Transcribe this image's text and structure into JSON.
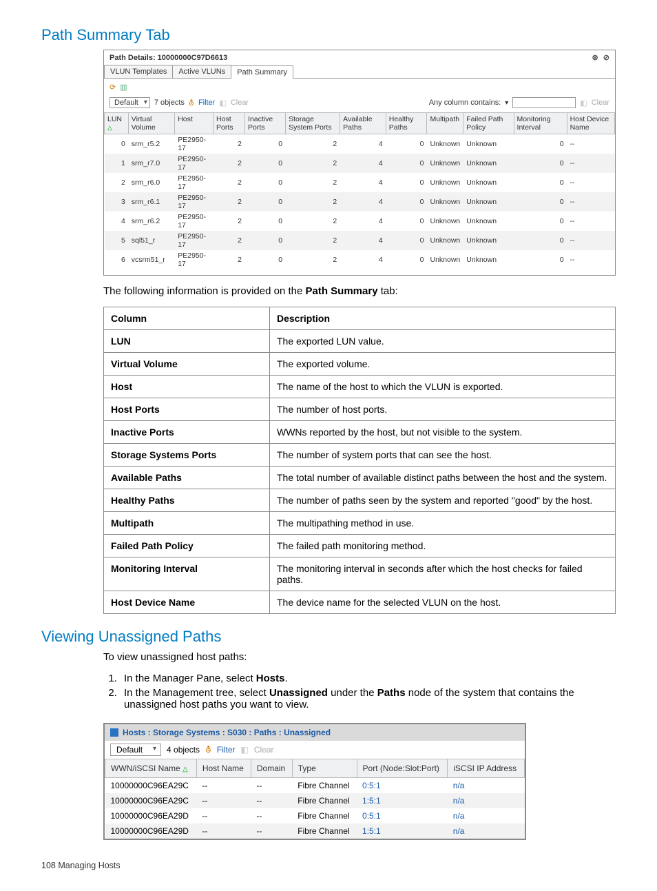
{
  "heading1": "Path Summary Tab",
  "panel1": {
    "title": "Path Details: 10000000C97D6613",
    "tabs": [
      "VLUN Templates",
      "Active VLUNs",
      "Path Summary"
    ],
    "activeTab": 2,
    "filter": {
      "default": "Default",
      "objects": "7 objects",
      "filter": "Filter",
      "clear": "Clear",
      "anycol": "Any column contains:",
      "clear2": "Clear"
    },
    "headers": [
      "LUN",
      "Virtual Volume",
      "Host",
      "Host Ports",
      "Inactive Ports",
      "Storage System Ports",
      "Available Paths",
      "Healthy Paths",
      "Multipath",
      "Failed Path Policy",
      "Monitoring Interval",
      "Host Device Name"
    ],
    "rows": [
      {
        "lun": "0",
        "vv": "srm_r5.2",
        "host": "PE2950-17",
        "hp": "2",
        "ip": "0",
        "sp": "2",
        "ap": "4",
        "heal": "0",
        "mp": "Unknown",
        "fp": "Unknown",
        "mi": "0",
        "hd": "--"
      },
      {
        "lun": "1",
        "vv": "srm_r7.0",
        "host": "PE2950-17",
        "hp": "2",
        "ip": "0",
        "sp": "2",
        "ap": "4",
        "heal": "0",
        "mp": "Unknown",
        "fp": "Unknown",
        "mi": "0",
        "hd": "--"
      },
      {
        "lun": "2",
        "vv": "srm_r6.0",
        "host": "PE2950-17",
        "hp": "2",
        "ip": "0",
        "sp": "2",
        "ap": "4",
        "heal": "0",
        "mp": "Unknown",
        "fp": "Unknown",
        "mi": "0",
        "hd": "--"
      },
      {
        "lun": "3",
        "vv": "srm_r6.1",
        "host": "PE2950-17",
        "hp": "2",
        "ip": "0",
        "sp": "2",
        "ap": "4",
        "heal": "0",
        "mp": "Unknown",
        "fp": "Unknown",
        "mi": "0",
        "hd": "--"
      },
      {
        "lun": "4",
        "vv": "srm_r6.2",
        "host": "PE2950-17",
        "hp": "2",
        "ip": "0",
        "sp": "2",
        "ap": "4",
        "heal": "0",
        "mp": "Unknown",
        "fp": "Unknown",
        "mi": "0",
        "hd": "--"
      },
      {
        "lun": "5",
        "vv": "sql51_r",
        "host": "PE2950-17",
        "hp": "2",
        "ip": "0",
        "sp": "2",
        "ap": "4",
        "heal": "0",
        "mp": "Unknown",
        "fp": "Unknown",
        "mi": "0",
        "hd": "--"
      },
      {
        "lun": "6",
        "vv": "vcsrm51_r",
        "host": "PE2950-17",
        "hp": "2",
        "ip": "0",
        "sp": "2",
        "ap": "4",
        "heal": "0",
        "mp": "Unknown",
        "fp": "Unknown",
        "mi": "0",
        "hd": "--"
      }
    ]
  },
  "lead1_a": "The following information is provided on the ",
  "lead1_b": "Path Summary",
  "lead1_c": " tab:",
  "descHeaders": {
    "col": "Column",
    "desc": "Description"
  },
  "descRows": [
    {
      "c": "LUN",
      "d": "The exported LUN value."
    },
    {
      "c": "Virtual Volume",
      "d": "The exported volume."
    },
    {
      "c": "Host",
      "d": "The name of the host to which the VLUN is exported."
    },
    {
      "c": "Host Ports",
      "d": "The number of host ports."
    },
    {
      "c": "Inactive Ports",
      "d": "WWNs reported by the host, but not visible to the system."
    },
    {
      "c": "Storage Systems Ports",
      "d": "The number of system ports that can see the host."
    },
    {
      "c": "Available Paths",
      "d": "The total number of available distinct paths between the host and the system."
    },
    {
      "c": "Healthy Paths",
      "d": "The number of paths seen by the system and reported \"good\" by the host."
    },
    {
      "c": "Multipath",
      "d": "The multipathing method in use."
    },
    {
      "c": "Failed Path Policy",
      "d": "The failed path monitoring method."
    },
    {
      "c": "Monitoring Interval",
      "d": "The monitoring interval in seconds after which the host checks for failed paths."
    },
    {
      "c": "Host Device Name",
      "d": "The device name for the selected VLUN on the host."
    }
  ],
  "heading2": "Viewing Unassigned Paths",
  "lead2": "To view unassigned host paths:",
  "steps": {
    "s1a": "In the Manager Pane, select ",
    "s1b": "Hosts",
    "s1c": ".",
    "s2a": "In the Management tree, select ",
    "s2b": "Unassigned",
    "s2c": " under the ",
    "s2d": "Paths",
    "s2e": " node of the system that contains the unassigned host paths you want to view."
  },
  "panel2": {
    "title": "Hosts : Storage Systems : S030 : Paths : Unassigned",
    "filter": {
      "default": "Default",
      "objects": "4 objects",
      "filter": "Filter",
      "clear": "Clear"
    },
    "headers": [
      "WWN/iSCSI Name",
      "Host Name",
      "Domain",
      "Type",
      "Port (Node:Slot:Port)",
      "iSCSI IP Address"
    ],
    "rows": [
      {
        "wwn": "10000000C96EA29C",
        "hn": "--",
        "dom": "--",
        "type": "Fibre Channel",
        "port": "0:5:1",
        "ip": "n/a"
      },
      {
        "wwn": "10000000C96EA29C",
        "hn": "--",
        "dom": "--",
        "type": "Fibre Channel",
        "port": "1:5:1",
        "ip": "n/a"
      },
      {
        "wwn": "10000000C96EA29D",
        "hn": "--",
        "dom": "--",
        "type": "Fibre Channel",
        "port": "0:5:1",
        "ip": "n/a"
      },
      {
        "wwn": "10000000C96EA29D",
        "hn": "--",
        "dom": "--",
        "type": "Fibre Channel",
        "port": "1:5:1",
        "ip": "n/a"
      }
    ]
  },
  "footer": "108   Managing Hosts"
}
